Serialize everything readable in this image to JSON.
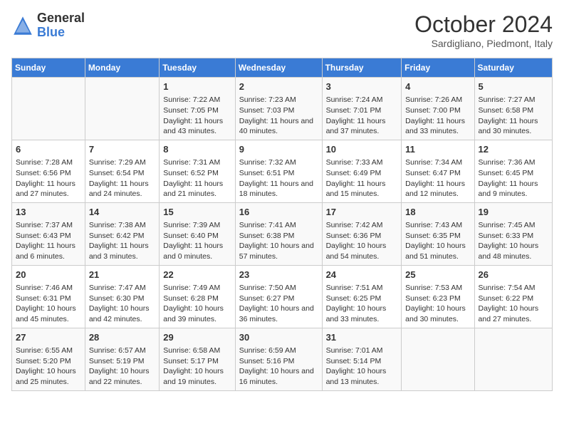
{
  "header": {
    "logo_general": "General",
    "logo_blue": "Blue",
    "month_title": "October 2024",
    "subtitle": "Sardigliano, Piedmont, Italy"
  },
  "days_of_week": [
    "Sunday",
    "Monday",
    "Tuesday",
    "Wednesday",
    "Thursday",
    "Friday",
    "Saturday"
  ],
  "weeks": [
    [
      {
        "day": "",
        "content": ""
      },
      {
        "day": "",
        "content": ""
      },
      {
        "day": "1",
        "content": "Sunrise: 7:22 AM\nSunset: 7:05 PM\nDaylight: 11 hours and 43 minutes."
      },
      {
        "day": "2",
        "content": "Sunrise: 7:23 AM\nSunset: 7:03 PM\nDaylight: 11 hours and 40 minutes."
      },
      {
        "day": "3",
        "content": "Sunrise: 7:24 AM\nSunset: 7:01 PM\nDaylight: 11 hours and 37 minutes."
      },
      {
        "day": "4",
        "content": "Sunrise: 7:26 AM\nSunset: 7:00 PM\nDaylight: 11 hours and 33 minutes."
      },
      {
        "day": "5",
        "content": "Sunrise: 7:27 AM\nSunset: 6:58 PM\nDaylight: 11 hours and 30 minutes."
      }
    ],
    [
      {
        "day": "6",
        "content": "Sunrise: 7:28 AM\nSunset: 6:56 PM\nDaylight: 11 hours and 27 minutes."
      },
      {
        "day": "7",
        "content": "Sunrise: 7:29 AM\nSunset: 6:54 PM\nDaylight: 11 hours and 24 minutes."
      },
      {
        "day": "8",
        "content": "Sunrise: 7:31 AM\nSunset: 6:52 PM\nDaylight: 11 hours and 21 minutes."
      },
      {
        "day": "9",
        "content": "Sunrise: 7:32 AM\nSunset: 6:51 PM\nDaylight: 11 hours and 18 minutes."
      },
      {
        "day": "10",
        "content": "Sunrise: 7:33 AM\nSunset: 6:49 PM\nDaylight: 11 hours and 15 minutes."
      },
      {
        "day": "11",
        "content": "Sunrise: 7:34 AM\nSunset: 6:47 PM\nDaylight: 11 hours and 12 minutes."
      },
      {
        "day": "12",
        "content": "Sunrise: 7:36 AM\nSunset: 6:45 PM\nDaylight: 11 hours and 9 minutes."
      }
    ],
    [
      {
        "day": "13",
        "content": "Sunrise: 7:37 AM\nSunset: 6:43 PM\nDaylight: 11 hours and 6 minutes."
      },
      {
        "day": "14",
        "content": "Sunrise: 7:38 AM\nSunset: 6:42 PM\nDaylight: 11 hours and 3 minutes."
      },
      {
        "day": "15",
        "content": "Sunrise: 7:39 AM\nSunset: 6:40 PM\nDaylight: 11 hours and 0 minutes."
      },
      {
        "day": "16",
        "content": "Sunrise: 7:41 AM\nSunset: 6:38 PM\nDaylight: 10 hours and 57 minutes."
      },
      {
        "day": "17",
        "content": "Sunrise: 7:42 AM\nSunset: 6:36 PM\nDaylight: 10 hours and 54 minutes."
      },
      {
        "day": "18",
        "content": "Sunrise: 7:43 AM\nSunset: 6:35 PM\nDaylight: 10 hours and 51 minutes."
      },
      {
        "day": "19",
        "content": "Sunrise: 7:45 AM\nSunset: 6:33 PM\nDaylight: 10 hours and 48 minutes."
      }
    ],
    [
      {
        "day": "20",
        "content": "Sunrise: 7:46 AM\nSunset: 6:31 PM\nDaylight: 10 hours and 45 minutes."
      },
      {
        "day": "21",
        "content": "Sunrise: 7:47 AM\nSunset: 6:30 PM\nDaylight: 10 hours and 42 minutes."
      },
      {
        "day": "22",
        "content": "Sunrise: 7:49 AM\nSunset: 6:28 PM\nDaylight: 10 hours and 39 minutes."
      },
      {
        "day": "23",
        "content": "Sunrise: 7:50 AM\nSunset: 6:27 PM\nDaylight: 10 hours and 36 minutes."
      },
      {
        "day": "24",
        "content": "Sunrise: 7:51 AM\nSunset: 6:25 PM\nDaylight: 10 hours and 33 minutes."
      },
      {
        "day": "25",
        "content": "Sunrise: 7:53 AM\nSunset: 6:23 PM\nDaylight: 10 hours and 30 minutes."
      },
      {
        "day": "26",
        "content": "Sunrise: 7:54 AM\nSunset: 6:22 PM\nDaylight: 10 hours and 27 minutes."
      }
    ],
    [
      {
        "day": "27",
        "content": "Sunrise: 6:55 AM\nSunset: 5:20 PM\nDaylight: 10 hours and 25 minutes."
      },
      {
        "day": "28",
        "content": "Sunrise: 6:57 AM\nSunset: 5:19 PM\nDaylight: 10 hours and 22 minutes."
      },
      {
        "day": "29",
        "content": "Sunrise: 6:58 AM\nSunset: 5:17 PM\nDaylight: 10 hours and 19 minutes."
      },
      {
        "day": "30",
        "content": "Sunrise: 6:59 AM\nSunset: 5:16 PM\nDaylight: 10 hours and 16 minutes."
      },
      {
        "day": "31",
        "content": "Sunrise: 7:01 AM\nSunset: 5:14 PM\nDaylight: 10 hours and 13 minutes."
      },
      {
        "day": "",
        "content": ""
      },
      {
        "day": "",
        "content": ""
      }
    ]
  ]
}
